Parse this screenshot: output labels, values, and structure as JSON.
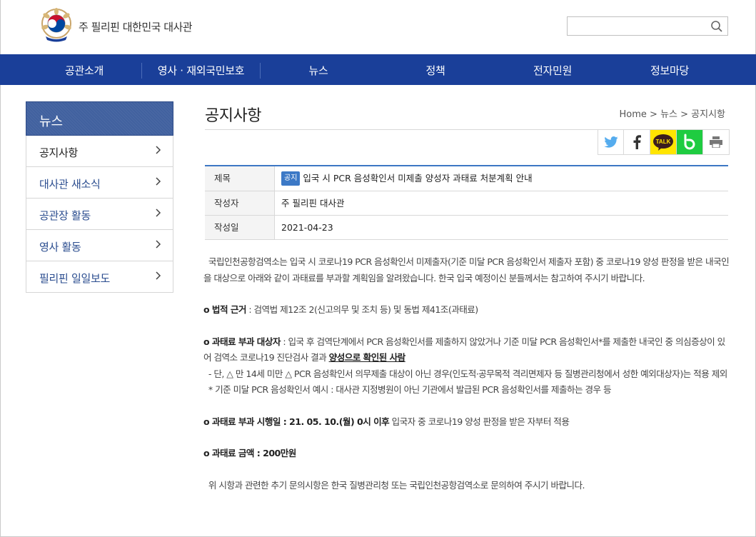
{
  "header": {
    "site_title": "주 필리핀 대한민국 대사관",
    "search_placeholder": ""
  },
  "gnb": [
    "공관소개",
    "영사 · 재외국민보호",
    "뉴스",
    "정책",
    "전자민원",
    "정보마당"
  ],
  "sidebar": {
    "title": "뉴스",
    "items": [
      {
        "label": "공지사항"
      },
      {
        "label": "대사관 새소식"
      },
      {
        "label": "공관장 활동"
      },
      {
        "label": "영사 활동"
      },
      {
        "label": "필리핀 일일보도"
      }
    ]
  },
  "content": {
    "page_title": "공지사항",
    "breadcrumb": "Home > 뉴스 > 공지시항",
    "share": {
      "kakao_label": "TALK"
    },
    "info": {
      "title_label": "제목",
      "badge": "공지",
      "title": "입국 시 PCR 음성확인서 미제출 양성자 과태료 처분계획 안내",
      "author_label": "작성자",
      "author": "주 필리핀 대사관",
      "date_label": "작성일",
      "date": "2021-04-23"
    },
    "body": {
      "p1": "  국립인천공항검역소는 입국 시 코로나19 PCR 음성확인서 미제출자(기준 미달 PCR 음성확인서 제출자 포함) 중 코로나19 양성 판정을 받은 내국인을 대상으로 아래와 같이 과태료를 부과할 계획임을 알려왔습니다. 한국 입국 예정이신 분들께서는 참고하여 주시기 바랍니다.",
      "law_label": "o 법적 근거",
      "law_text": " : 검역법 제12조 2(신고의무 및 조치 등) 및 동법 제41조(과태료)",
      "target_label": "o 과태료 부과 대상자",
      "target_text": " : 입국 후 검역단계에서 PCR 음성확인서를 제출하지 않았거나 기준 미달 PCR 음성확인서*를 제출한 내국인 중 의심증상이 있어 검역소 코로나19 진단검사 결과 ",
      "target_emph": "양성으로 확인된 사람",
      "exception": "  - 단, △ 만 14세 미만 △ PCR 음성확인서 의무제출 대상이 아닌 경우(인도적·공무목적 격리면제자 등 질병관리청에서 성한 예외대상자)는 적용 제외",
      "note": "  * 기준 미달 PCR 음성확인서 예시 : 대사관 지정병원이 아닌 기관에서 발급된 PCR 음성확인서를 제출하는 경우 등",
      "effective_label": "o 과태료 부과 시행일 : 21. 05. 10.(월) 0시 이후",
      "effective_text": " 입국자 중 코로나19 양성 판정을 받은 자부터 적용",
      "amount_label": "o 과태료 금액 : 200만원",
      "closing": "  위 시항과 관련한 추기 문의시항은 한국 질병관리청 또는 국립인천공항검역소로 문의하여 주시기 바랍니다."
    }
  },
  "colors": {
    "nav": "#1a3f99",
    "sidebar_title": "#41619f",
    "accent": "#3d77c4",
    "kakao": "#ffe500",
    "band": "#1fcc41",
    "twitter": "#55acee",
    "facebook": "#3b5998"
  },
  "icons": [
    "emblem-logo",
    "search-icon",
    "twitter-icon",
    "facebook-icon",
    "kakaotalk-icon",
    "band-icon",
    "print-icon",
    "chevron-right-icon"
  ]
}
